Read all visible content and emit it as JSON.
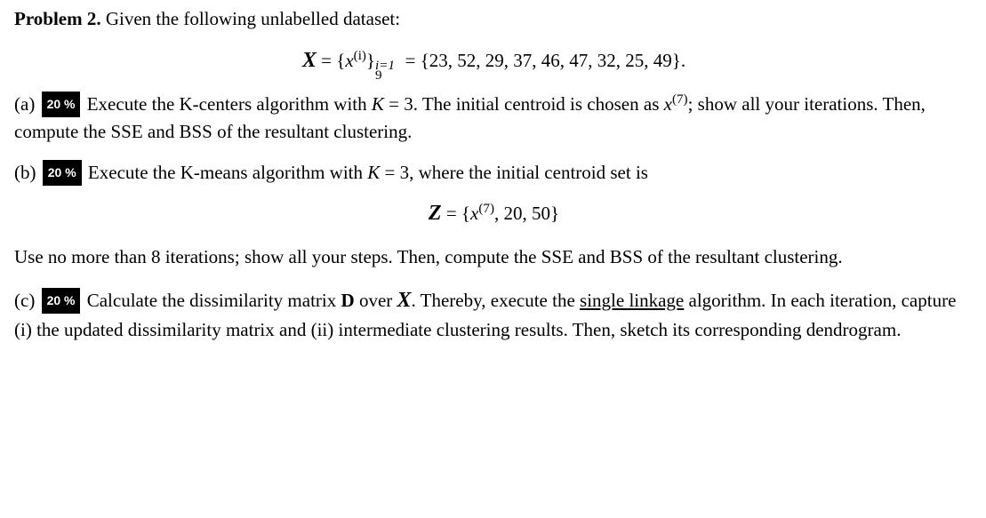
{
  "problem": {
    "title": "Problem 2.",
    "intro": " Given the following unlabelled dataset:"
  },
  "math1": {
    "lhs_script": "X",
    "eq1": " = {",
    "var_x": "x",
    "sup_i": "(i)",
    "brace_close": "}",
    "sub9": "9",
    "subi1": "i=1",
    "eq2": "= {23, 52, 29, 37, 46, 47, 32, 25, 49}."
  },
  "partA": {
    "label": "(a)",
    "pct": "20 %",
    "body_pre": "Execute the K-centers algorithm with ",
    "K": "K",
    "eq3": " = 3. The initial centroid is chosen as ",
    "x": "x",
    "sup7": "(7)",
    "body_post": "; show all your iterations. Then, compute the SSE and BSS of the resultant clustering."
  },
  "partB": {
    "label": "(b)",
    "pct": "20 %",
    "body_pre": "Execute the K-means algorithm with ",
    "K": "K",
    "eq3": " = 3, where the initial centroid set is"
  },
  "math2": {
    "lhs_script": "Z",
    "eq": " = {",
    "x": "x",
    "sup7": "(7)",
    "rest": ", 20, 50}"
  },
  "partB2": {
    "body": "Use no more than 8 iterations; show all your steps. Then, compute the SSE and BSS of the resultant clustering."
  },
  "partC": {
    "label": "(c)",
    "pct": "20 %",
    "body_pre": "Calculate the dissimilarity matrix ",
    "D": "D",
    "over": " over ",
    "scriptX": "X",
    "period": ". Thereby, execute the ",
    "linkText": "single linkage",
    "body_post": " algorithm. In each iteration, capture (i) the updated dissimilarity matrix and (ii) intermediate clustering results. Then, sketch its corresponding dendrogram."
  }
}
